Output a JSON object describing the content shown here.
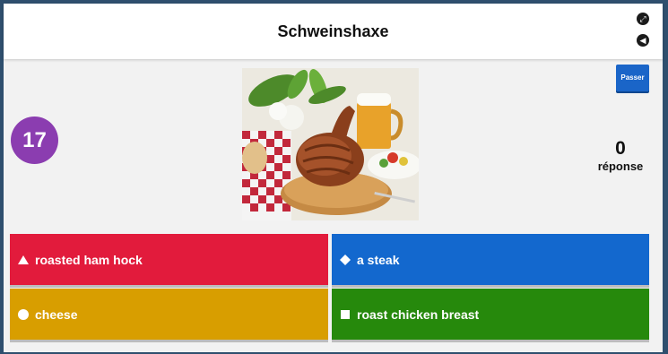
{
  "header": {
    "title": "Schweinshaxe"
  },
  "controls": {
    "skip_label": "Passer"
  },
  "game": {
    "timer": "17",
    "answers_count": "0",
    "answers_label": "réponse"
  },
  "answers": [
    {
      "label": "roasted ham hock",
      "shape": "triangle",
      "color": "#e21b3c"
    },
    {
      "label": "a steak",
      "shape": "diamond",
      "color": "#1368ce"
    },
    {
      "label": "cheese",
      "shape": "circle",
      "color": "#d89e00"
    },
    {
      "label": "roast chicken breast",
      "shape": "square",
      "color": "#26890c"
    }
  ]
}
